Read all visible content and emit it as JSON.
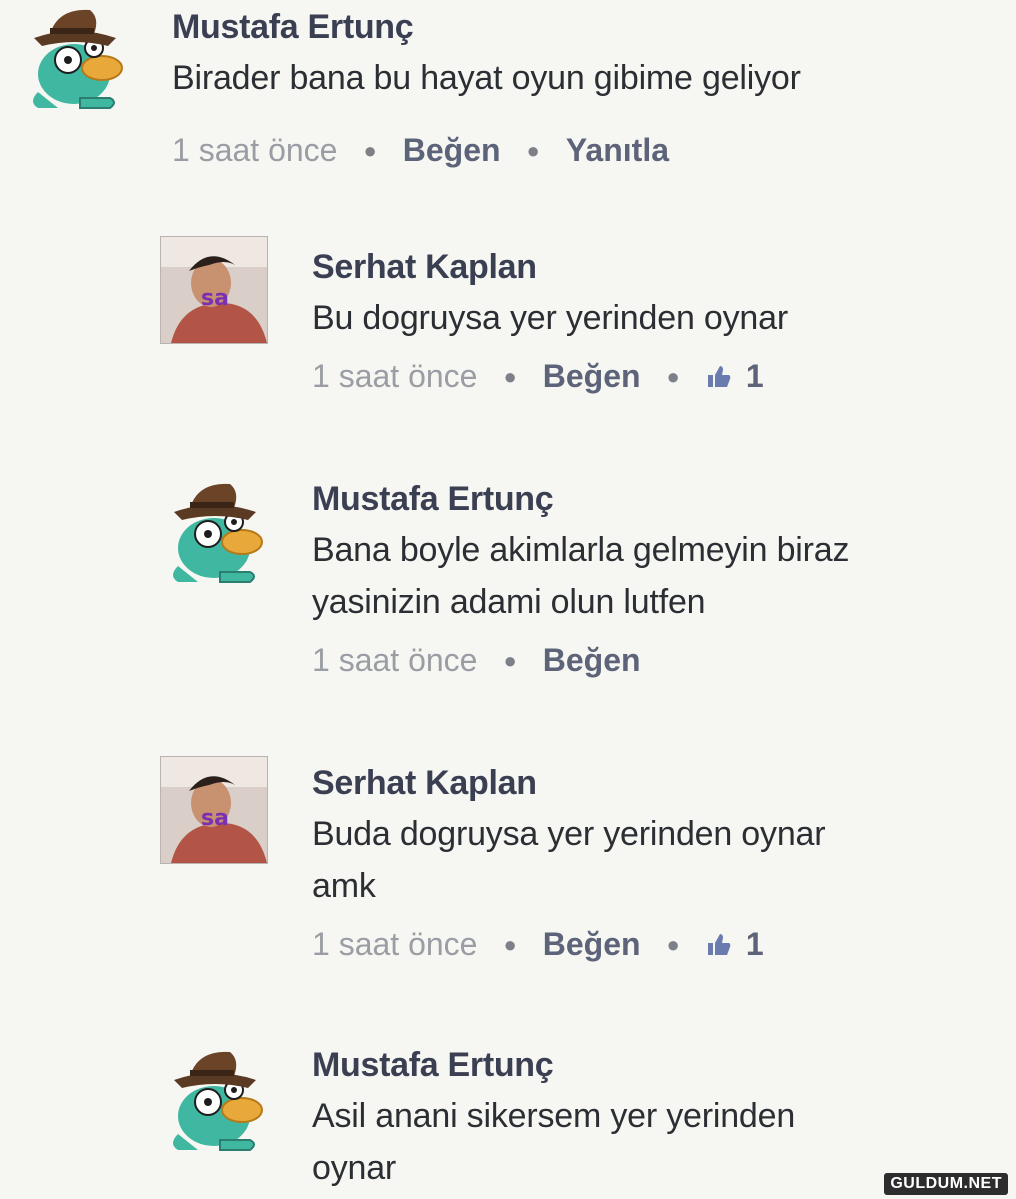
{
  "comments": [
    {
      "author": "Mustafa Ertunç",
      "lines": [
        "Birader bana bu hayat oyun gibime geliyor"
      ],
      "time": "1 saat önce",
      "like_label": "Beğen",
      "reply_label": "Yanıtla",
      "likes": null
    },
    {
      "author": "Serhat Kaplan",
      "lines": [
        "Bu dogruysa yer yerinden oynar"
      ],
      "time": "1 saat önce",
      "like_label": "Beğen",
      "reply_label": null,
      "likes": "1"
    },
    {
      "author": "Mustafa Ertunç",
      "lines": [
        "Bana boyle akimlarla gelmeyin biraz",
        "yasinizin adami olun lutfen"
      ],
      "time": "1 saat önce",
      "like_label": "Beğen",
      "reply_label": null,
      "likes": null
    },
    {
      "author": "Serhat Kaplan",
      "lines": [
        "Buda dogruysa yer yerinden oynar",
        "amk"
      ],
      "time": "1 saat önce",
      "like_label": "Beğen",
      "reply_label": null,
      "likes": "1"
    },
    {
      "author": "Mustafa Ertunç",
      "lines": [
        "Asil anani sikersem yer yerinden",
        "oynar"
      ],
      "time": null,
      "like_label": null,
      "reply_label": null,
      "likes": null
    }
  ],
  "avatar_sticker_text": "sa",
  "watermark": "GULDUM.NET",
  "icons": {
    "like_count": "thumbs-up-icon",
    "separator": "dot"
  },
  "colors": {
    "author": "#3b3f52",
    "meta": "#9a9da3",
    "background": "#f6f7f3"
  }
}
